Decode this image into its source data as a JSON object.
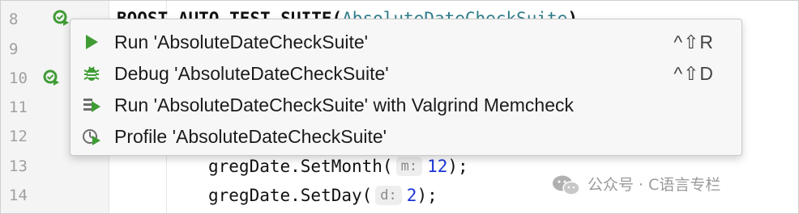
{
  "editor": {
    "line_numbers": [
      "8",
      "9",
      "10",
      "11",
      "12",
      "13",
      "14"
    ],
    "top_line": {
      "keyword": "BOOST_AUTO_TEST_SUITE(",
      "argument": "AbsoluteDateCheckSuite",
      "close": ")"
    },
    "lines": [
      {
        "code": "gregDate.SetMonth(",
        "hint": "m:",
        "value": "12",
        "end": ");"
      },
      {
        "code": "gregDate.SetDay(",
        "hint": "d:",
        "value": "2",
        "end": ");"
      }
    ]
  },
  "context_menu": {
    "items": [
      {
        "label": "Run 'AbsoluteDateCheckSuite'",
        "shortcut": "^⇧R",
        "icon": "run-icon"
      },
      {
        "label": "Debug 'AbsoluteDateCheckSuite'",
        "shortcut": "^⇧D",
        "icon": "debug-icon"
      },
      {
        "label": "Run 'AbsoluteDateCheckSuite' with Valgrind Memcheck",
        "shortcut": "",
        "icon": "valgrind-icon"
      },
      {
        "label": "Profile 'AbsoluteDateCheckSuite'",
        "shortcut": "",
        "icon": "profile-icon"
      }
    ]
  },
  "watermark": {
    "text": "公众号 · C语言专栏",
    "icon": "wechat-icon"
  },
  "colors": {
    "run_green": "#3f9c35",
    "gutter_bg": "#f4f4f4",
    "popup_bg": "#f7f7f7",
    "number_blue": "#1a35d6"
  }
}
